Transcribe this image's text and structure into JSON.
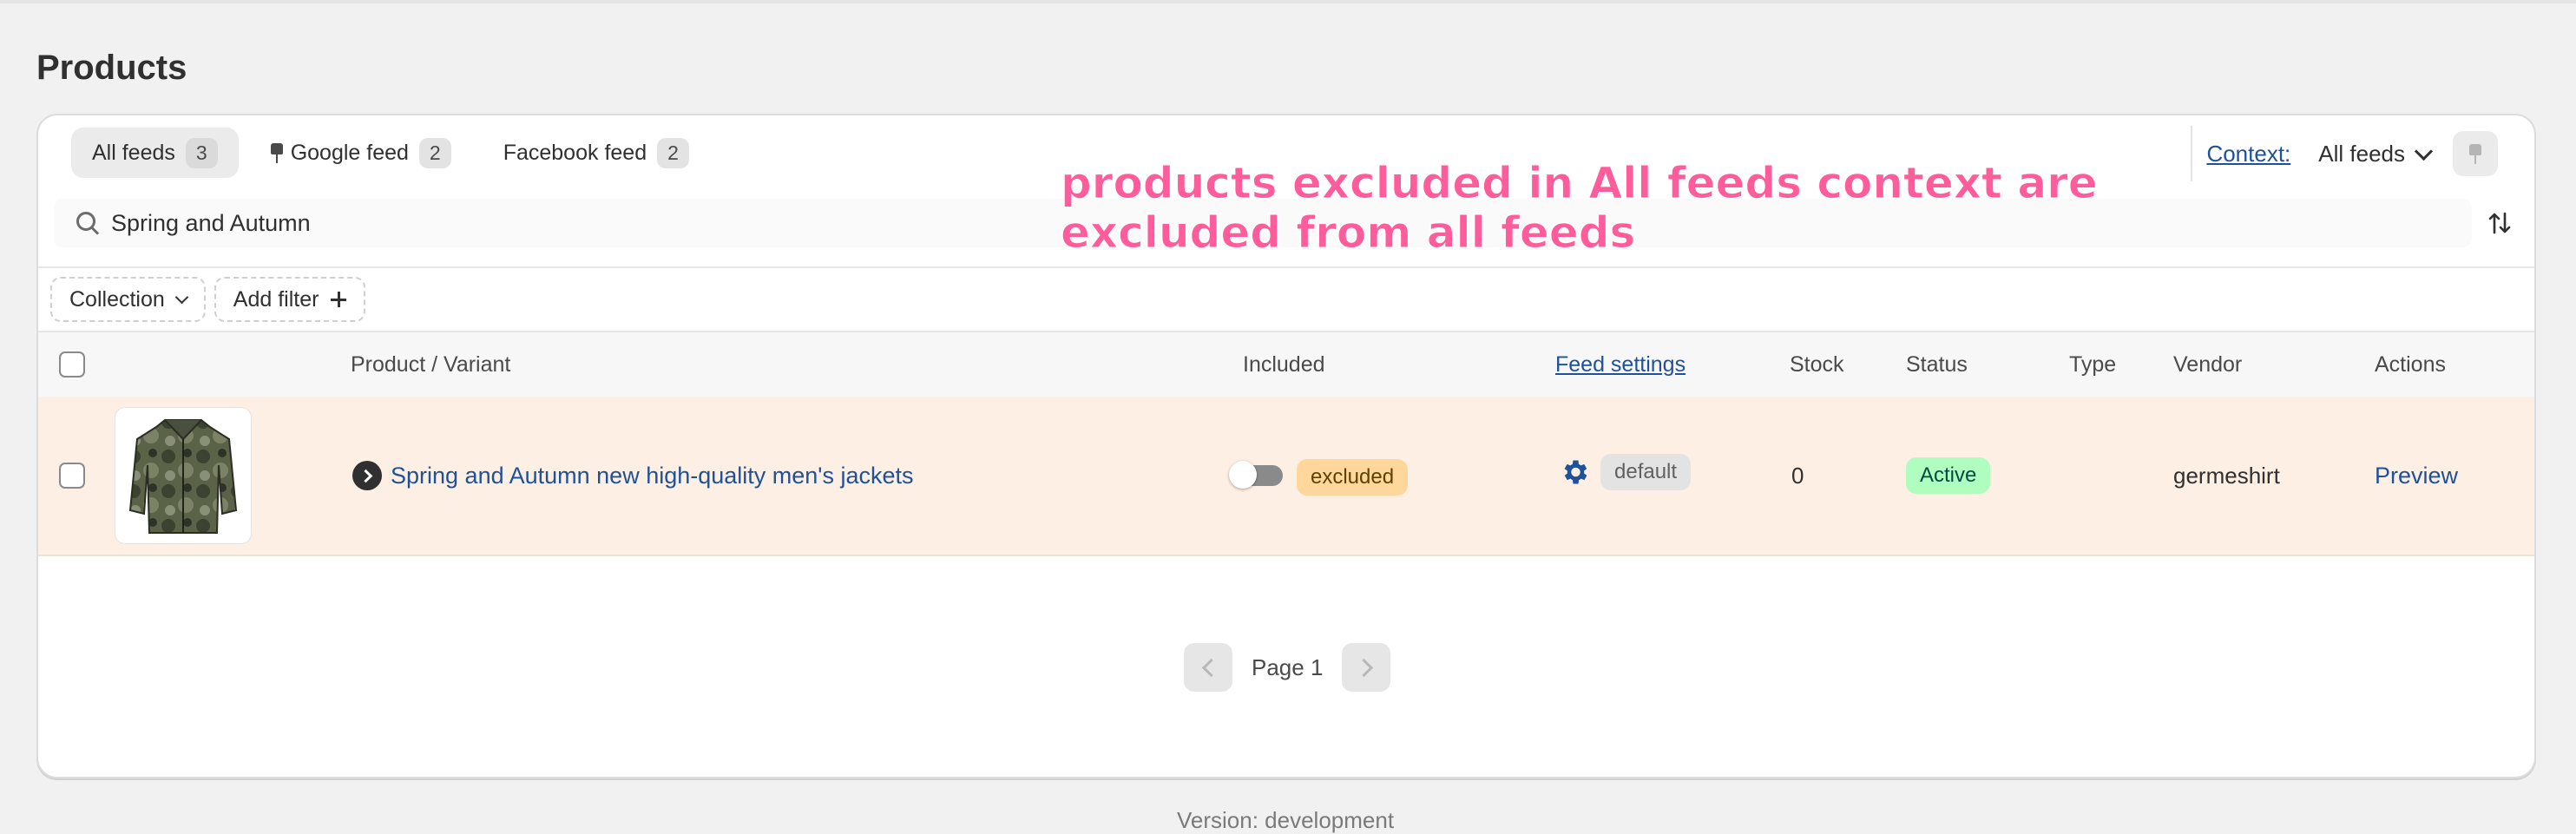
{
  "page": {
    "title": "Products"
  },
  "tabs": [
    {
      "label": "All feeds",
      "count": "3",
      "active": true
    },
    {
      "label": "Google feed",
      "count": "2",
      "icon": "pin-icon"
    },
    {
      "label": "Facebook feed",
      "count": "2"
    }
  ],
  "context": {
    "label": "Context:",
    "value": "All feeds"
  },
  "search": {
    "value": "Spring and Autumn"
  },
  "annotation": {
    "line1": "products excluded in All feeds context are",
    "line2": "excluded from all feeds"
  },
  "filters": {
    "collection": "Collection",
    "add_filter": "Add filter"
  },
  "table": {
    "headers": {
      "product": "Product / Variant",
      "included": "Included",
      "feed_settings": "Feed settings",
      "stock": "Stock",
      "status": "Status",
      "type": "Type",
      "vendor": "Vendor",
      "actions": "Actions"
    },
    "rows": [
      {
        "product": "Spring and Autumn new high-quality men's jackets",
        "included_badge": "excluded",
        "included_on": false,
        "feed_setting": "default",
        "stock": "0",
        "status": "Active",
        "type": "",
        "vendor": "germeshirt",
        "action": "Preview"
      }
    ]
  },
  "pagination": {
    "label": "Page 1"
  },
  "footer": {
    "text": "Version: development"
  },
  "colors": {
    "row_highlight": "#fdefe3",
    "link": "#1f5199",
    "annotation": "#ff5c9b",
    "active_badge": "#affebf",
    "excluded_badge": "#ffd79d"
  }
}
